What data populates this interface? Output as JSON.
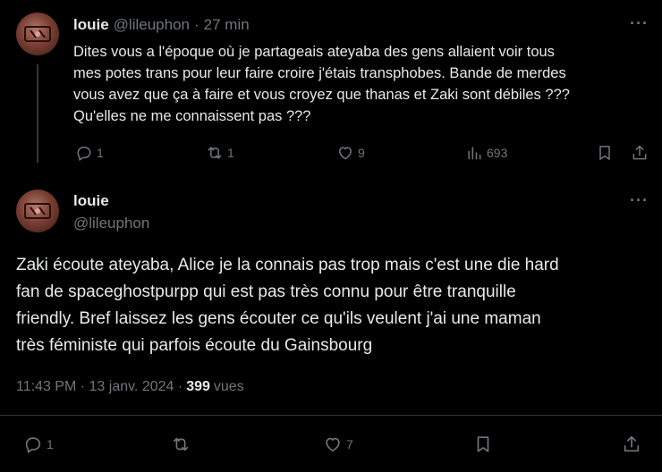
{
  "reply_tweet": {
    "author_name": "louie",
    "author_handle": "@lileuphon",
    "separator": "·",
    "time_ago": "27 min",
    "more_label": "···",
    "lines": [
      "Dites vous a l'époque où je partageais ateyaba des gens allaient voir tous",
      "mes potes trans pour leur faire croire j'étais transphobes. Bande de merdes",
      "vous avez que ça à faire et vous croyez que thanas et Zaki sont débiles ???",
      "Qu'elles ne me connaissent pas ???"
    ],
    "actions": {
      "reply_count": "1",
      "repost_count": "1",
      "like_count": "9",
      "views_count": "693"
    }
  },
  "main_tweet": {
    "author_name": "louie",
    "author_handle": "@lileuphon",
    "more_label": "···",
    "lines": [
      "Zaki écoute ateyaba, Alice je la connais pas trop mais c'est une die hard",
      "fan de spaceghostpurpp qui est pas très connu pour être tranquille",
      "friendly. Bref laissez les gens écouter ce qu'ils veulent j'ai une maman",
      "très féministe qui parfois écoute du Gainsbourg"
    ],
    "timestamp": "11:43 PM · 13 janv. 2024 ·",
    "views_count": "399",
    "views_label": "vues",
    "actions": {
      "reply_count": "1",
      "like_count": "7"
    }
  },
  "colors": {
    "background": "#000000",
    "text_primary": "#e7e9ea",
    "text_secondary": "#71767b",
    "divider": "#2f3336"
  }
}
